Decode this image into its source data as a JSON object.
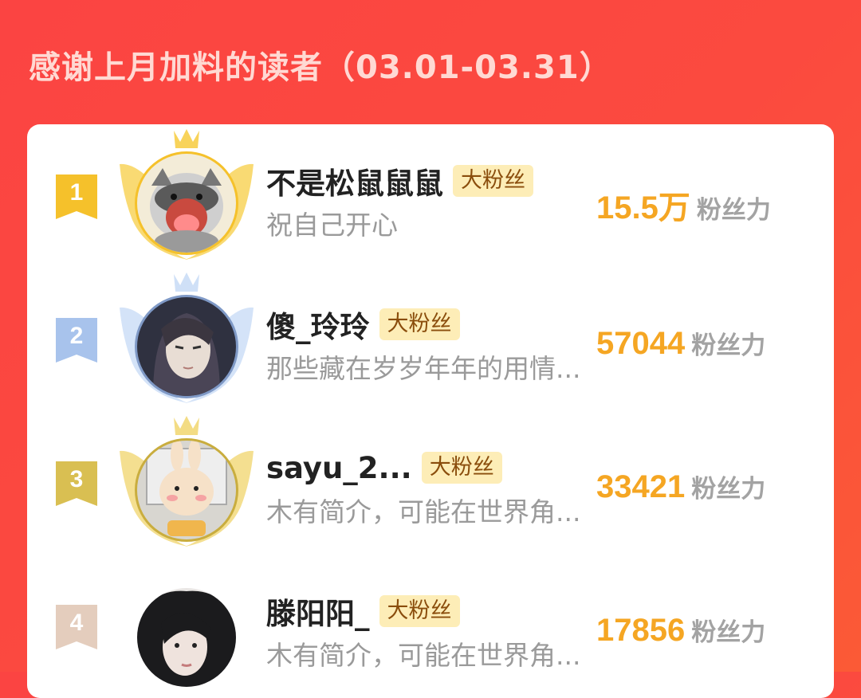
{
  "header": {
    "title": "感谢上月加料的读者（03.01-03.31）"
  },
  "colors": {
    "background": "#fb4a3f",
    "gold": "#f5c12b",
    "silver_blue": "#a8c3ec",
    "bronze": "#d9bf52",
    "score": "#f5a623"
  },
  "readers": [
    {
      "rank": "1",
      "nickname": "不是松鼠鼠鼠",
      "badge": "大粉丝",
      "bio": "祝自己开心",
      "score": "15.5万",
      "score_unit": "粉丝力",
      "medal": "gold"
    },
    {
      "rank": "2",
      "nickname": "傻_玲玲",
      "badge": "大粉丝",
      "bio": "那些藏在岁岁年年的用情...",
      "score": "57044",
      "score_unit": "粉丝力",
      "medal": "silver"
    },
    {
      "rank": "3",
      "nickname": "sayu_2...",
      "badge": "大粉丝",
      "bio": "木有简介，可能在世界角...",
      "score": "33421",
      "score_unit": "粉丝力",
      "medal": "bronze"
    },
    {
      "rank": "4",
      "nickname": "滕阳阳_",
      "badge": "大粉丝",
      "bio": "木有简介，可能在世界角...",
      "score": "17856",
      "score_unit": "粉丝力",
      "medal": "none"
    }
  ]
}
